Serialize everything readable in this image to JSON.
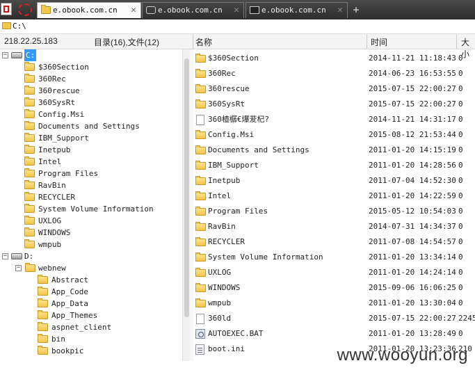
{
  "tabs": [
    {
      "label": "e.obook.com.cn",
      "icon": "folder-icon",
      "active": true
    },
    {
      "label": "e.obook.com.cn",
      "icon": "database-icon",
      "active": false
    },
    {
      "label": "e.obook.com.cn",
      "icon": "terminal-icon",
      "active": false
    }
  ],
  "tab_close": "✕",
  "new_tab": "+",
  "address": {
    "value": "C:\\"
  },
  "info": {
    "ip": "218.22.25.183",
    "counts": "目录(16),文件(12)"
  },
  "columns": {
    "name": "名称",
    "time": "时间",
    "size": "大小"
  },
  "tree": [
    {
      "label": "C:",
      "type": "drive",
      "level": 0,
      "expander": "−",
      "selected": true
    },
    {
      "label": "$360Section",
      "type": "folder",
      "level": 1
    },
    {
      "label": "360Rec",
      "type": "folder",
      "level": 1
    },
    {
      "label": "360rescue",
      "type": "folder",
      "level": 1
    },
    {
      "label": "360SysRt",
      "type": "folder",
      "level": 1
    },
    {
      "label": "Config.Msi",
      "type": "folder",
      "level": 1
    },
    {
      "label": "Documents and Settings",
      "type": "folder",
      "level": 1
    },
    {
      "label": "IBM_Support",
      "type": "folder",
      "level": 1
    },
    {
      "label": "Inetpub",
      "type": "folder",
      "level": 1
    },
    {
      "label": "Intel",
      "type": "folder",
      "level": 1
    },
    {
      "label": "Program Files",
      "type": "folder",
      "level": 1
    },
    {
      "label": "RavBin",
      "type": "folder",
      "level": 1
    },
    {
      "label": "RECYCLER",
      "type": "folder",
      "level": 1
    },
    {
      "label": "System Volume Information",
      "type": "folder",
      "level": 1
    },
    {
      "label": "UXLOG",
      "type": "folder",
      "level": 1
    },
    {
      "label": "WINDOWS",
      "type": "folder",
      "level": 1
    },
    {
      "label": "wmpub",
      "type": "folder",
      "level": 1
    },
    {
      "label": "D:",
      "type": "drive",
      "level": 0,
      "expander": "−"
    },
    {
      "label": "webnew",
      "type": "folder",
      "level": 1,
      "expander": "−"
    },
    {
      "label": "Abstract",
      "type": "folder",
      "level": 2
    },
    {
      "label": "App_Code",
      "type": "folder",
      "level": 2
    },
    {
      "label": "App_Data",
      "type": "folder",
      "level": 2
    },
    {
      "label": "App_Themes",
      "type": "folder",
      "level": 2
    },
    {
      "label": "aspnet_client",
      "type": "folder",
      "level": 2
    },
    {
      "label": "bin",
      "type": "folder",
      "level": 2
    },
    {
      "label": "bookpic",
      "type": "folder",
      "level": 2
    }
  ],
  "files": [
    {
      "name": "$360Section",
      "time": "2014-11-21 11:18:43",
      "size": "0",
      "type": "folder"
    },
    {
      "name": "360Rec",
      "time": "2014-06-23 16:53:55",
      "size": "0",
      "type": "folder"
    },
    {
      "name": "360rescue",
      "time": "2015-07-15 22:00:27",
      "size": "0",
      "type": "folder"
    },
    {
      "name": "360SysRt",
      "time": "2015-07-15 22:00:27",
      "size": "0",
      "type": "folder"
    },
    {
      "name": "360楂樼€爆茇杞?",
      "time": "2014-11-21 14:31:17",
      "size": "0",
      "type": "doc"
    },
    {
      "name": "Config.Msi",
      "time": "2015-08-12 21:53:44",
      "size": "0",
      "type": "folder"
    },
    {
      "name": "Documents and Settings",
      "time": "2011-01-20 14:15:19",
      "size": "0",
      "type": "folder"
    },
    {
      "name": "IBM_Support",
      "time": "2011-01-20 14:28:56",
      "size": "0",
      "type": "folder"
    },
    {
      "name": "Inetpub",
      "time": "2011-07-04 14:52:30",
      "size": "0",
      "type": "folder"
    },
    {
      "name": "Intel",
      "time": "2011-01-20 14:22:59",
      "size": "0",
      "type": "folder"
    },
    {
      "name": "Program Files",
      "time": "2015-05-12 10:54:03",
      "size": "0",
      "type": "folder"
    },
    {
      "name": "RavBin",
      "time": "2014-07-31 14:34:37",
      "size": "0",
      "type": "folder"
    },
    {
      "name": "RECYCLER",
      "time": "2011-07-08 14:54:57",
      "size": "0",
      "type": "folder"
    },
    {
      "name": "System Volume Information",
      "time": "2011-01-20 13:34:14",
      "size": "0",
      "type": "folder"
    },
    {
      "name": "UXLOG",
      "time": "2011-01-20 14:24:14",
      "size": "0",
      "type": "folder"
    },
    {
      "name": "WINDOWS",
      "time": "2015-09-06 16:06:25",
      "size": "0",
      "type": "folder"
    },
    {
      "name": "wmpub",
      "time": "2011-01-20 13:30:04",
      "size": "0",
      "type": "folder"
    },
    {
      "name": "360ld",
      "time": "2015-07-15 22:00:27",
      "size": "2245",
      "type": "doc"
    },
    {
      "name": "AUTOEXEC.BAT",
      "time": "2011-01-20 13:28:49",
      "size": "0",
      "type": "bat"
    },
    {
      "name": "boot.ini",
      "time": "2011-01-20 13:23:36",
      "size": "210",
      "type": "ini"
    }
  ],
  "watermark": "www.wooyun.org",
  "colors": {
    "selection": "#3399ff",
    "folder": "#f2c44a",
    "tabbar": "#3a3a3a"
  }
}
